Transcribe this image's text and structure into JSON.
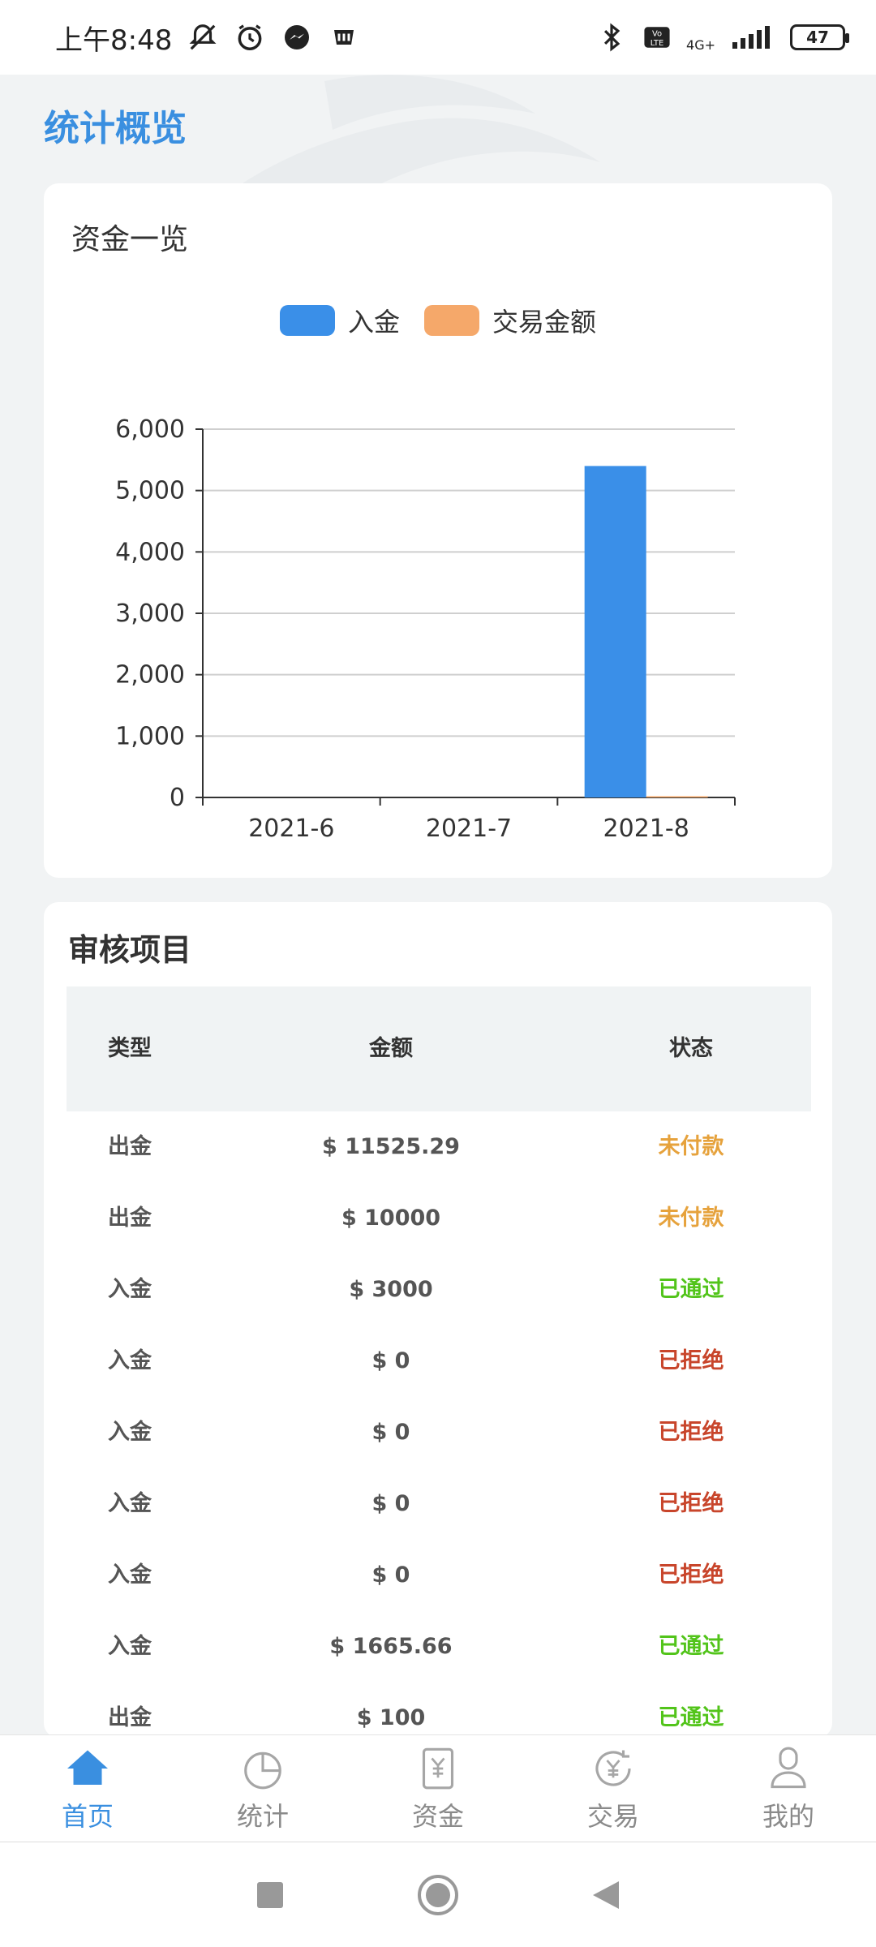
{
  "status_bar": {
    "time": "上午8:48",
    "network": "4G+",
    "battery": "47"
  },
  "page_title": "统计概览",
  "fund_overview": {
    "title": "资金一览",
    "chart_data": {
      "type": "bar",
      "categories": [
        "2021-6",
        "2021-7",
        "2021-8"
      ],
      "series": [
        {
          "name": "入金",
          "color": "#3a8fe8",
          "values": [
            0,
            0,
            5400
          ]
        },
        {
          "name": "交易金额",
          "color": "#f5a86a",
          "values": [
            0,
            0,
            20
          ]
        }
      ],
      "yticks": [
        "6,000",
        "5,000",
        "4,000",
        "3,000",
        "2,000",
        "1,000",
        "0"
      ],
      "ylim": [
        0,
        6000
      ],
      "grid": true,
      "legend": "top-center"
    }
  },
  "review": {
    "title": "审核项目",
    "columns": {
      "type": "类型",
      "amount": "金额",
      "status": "状态"
    },
    "rows": [
      {
        "type": "出金",
        "amount": "$ 11525.29",
        "status": "未付款",
        "status_color": "#e6a23c"
      },
      {
        "type": "出金",
        "amount": "$ 10000",
        "status": "未付款",
        "status_color": "#e6a23c"
      },
      {
        "type": "入金",
        "amount": "$ 3000",
        "status": "已通过",
        "status_color": "#52c41a"
      },
      {
        "type": "入金",
        "amount": "$ 0",
        "status": "已拒绝",
        "status_color": "#c8452b"
      },
      {
        "type": "入金",
        "amount": "$ 0",
        "status": "已拒绝",
        "status_color": "#c8452b"
      },
      {
        "type": "入金",
        "amount": "$ 0",
        "status": "已拒绝",
        "status_color": "#c8452b"
      },
      {
        "type": "入金",
        "amount": "$ 0",
        "status": "已拒绝",
        "status_color": "#c8452b"
      },
      {
        "type": "入金",
        "amount": "$ 1665.66",
        "status": "已通过",
        "status_color": "#52c41a"
      },
      {
        "type": "出金",
        "amount": "$ 100",
        "status": "已通过",
        "status_color": "#52c41a"
      }
    ]
  },
  "tabs": [
    {
      "label": "首页",
      "icon": "home-icon",
      "active": true
    },
    {
      "label": "统计",
      "icon": "pie-chart-icon",
      "active": false
    },
    {
      "label": "资金",
      "icon": "fund-icon",
      "active": false
    },
    {
      "label": "交易",
      "icon": "trade-icon",
      "active": false
    },
    {
      "label": "我的",
      "icon": "user-icon",
      "active": false
    }
  ],
  "colors": {
    "accent": "#3a8fe0",
    "inactive": "#8a8a8a"
  }
}
